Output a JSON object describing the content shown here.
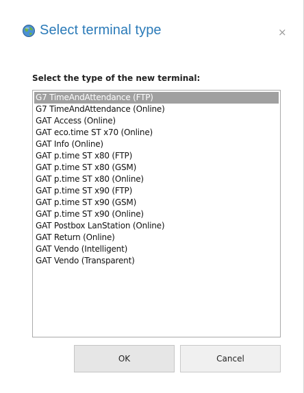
{
  "dialog": {
    "title": "Select terminal type",
    "close_label": "×",
    "prompt": "Select the type of the new terminal:",
    "selected_index": 0,
    "terminal_types": [
      "G7 TimeAndAttendance (FTP)",
      "G7 TimeAndAttendance (Online)",
      "GAT Access (Online)",
      "GAT eco.time ST x70 (Online)",
      "GAT Info (Online)",
      "GAT p.time ST x80 (FTP)",
      "GAT p.time ST x80 (GSM)",
      "GAT p.time ST x80 (Online)",
      "GAT p.time ST x90 (FTP)",
      "GAT p.time ST x90 (GSM)",
      "GAT p.time ST x90 (Online)",
      "GAT Postbox LanStation (Online)",
      "GAT Return (Online)",
      "GAT Vendo (Intelligent)",
      "GAT Vendo (Transparent)"
    ],
    "buttons": {
      "ok_label": "OK",
      "cancel_label": "Cancel"
    },
    "icons": {
      "title_icon": "globe-icon",
      "close_icon": "close-icon"
    },
    "colors": {
      "title": "#2a7ab8",
      "selection_bg": "#a0a0a0"
    }
  }
}
